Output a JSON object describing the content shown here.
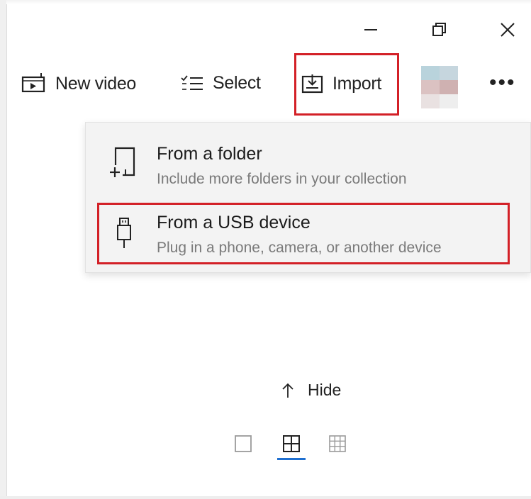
{
  "window": {
    "controls": [
      "minimize",
      "restore",
      "close"
    ]
  },
  "toolbar": {
    "new_video_label": "New video",
    "select_label": "Select",
    "import_label": "Import",
    "more_label": "•••"
  },
  "import_menu": {
    "items": [
      {
        "title": "From a folder",
        "subtitle": "Include more folders in your collection",
        "icon": "add-folder-icon"
      },
      {
        "title": "From a USB device",
        "subtitle": "Plug in a phone, camera, or another device",
        "icon": "usb-icon"
      }
    ]
  },
  "view": {
    "hide_label": "Hide",
    "options": [
      "single",
      "medium-grid",
      "small-grid"
    ],
    "selected": "medium-grid"
  },
  "colors": {
    "highlight_red": "#d32027",
    "accent_blue": "#1e6fd0",
    "menu_bg": "#f3f3f3"
  }
}
